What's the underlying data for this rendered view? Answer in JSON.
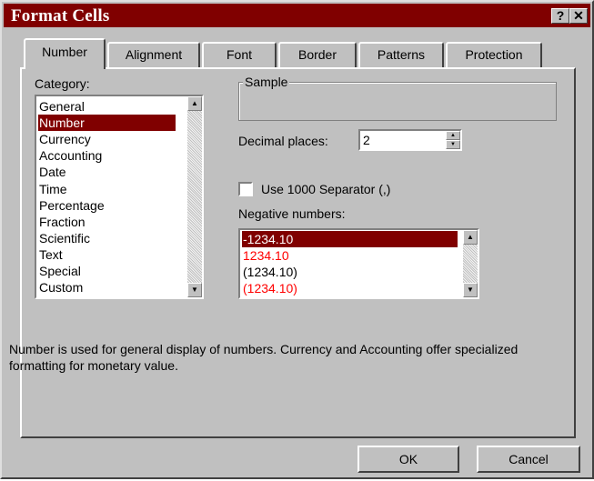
{
  "window": {
    "title": "Format Cells",
    "help_button": "?",
    "close_button": "✕"
  },
  "tabs": [
    {
      "label": "Number",
      "active": true
    },
    {
      "label": "Alignment",
      "active": false
    },
    {
      "label": "Font",
      "active": false
    },
    {
      "label": "Border",
      "active": false
    },
    {
      "label": "Patterns",
      "active": false
    },
    {
      "label": "Protection",
      "active": false
    }
  ],
  "category": {
    "label": "Category:",
    "items": [
      "General",
      "Number",
      "Currency",
      "Accounting",
      "Date",
      "Time",
      "Percentage",
      "Fraction",
      "Scientific",
      "Text",
      "Special",
      "Custom"
    ],
    "selected_index": 1
  },
  "sample": {
    "label": "Sample",
    "value": ""
  },
  "decimal_places": {
    "label": "Decimal places:",
    "value": "2"
  },
  "separator": {
    "label": "Use 1000 Separator (,)",
    "checked": false
  },
  "negative_numbers": {
    "label": "Negative numbers:",
    "items": [
      {
        "text": "-1234.10",
        "color": "#000000"
      },
      {
        "text": "1234.10",
        "color": "#ff0000"
      },
      {
        "text": "(1234.10)",
        "color": "#000000"
      },
      {
        "text": "(1234.10)",
        "color": "#ff0000"
      }
    ],
    "selected_index": 0
  },
  "description": "Number is used for general display of numbers.  Currency and Accounting offer specialized formatting for monetary value.",
  "buttons": {
    "ok": "OK",
    "cancel": "Cancel"
  },
  "colors": {
    "title_bar": "#800000",
    "selection": "#800000",
    "face": "#c0c0c0"
  }
}
